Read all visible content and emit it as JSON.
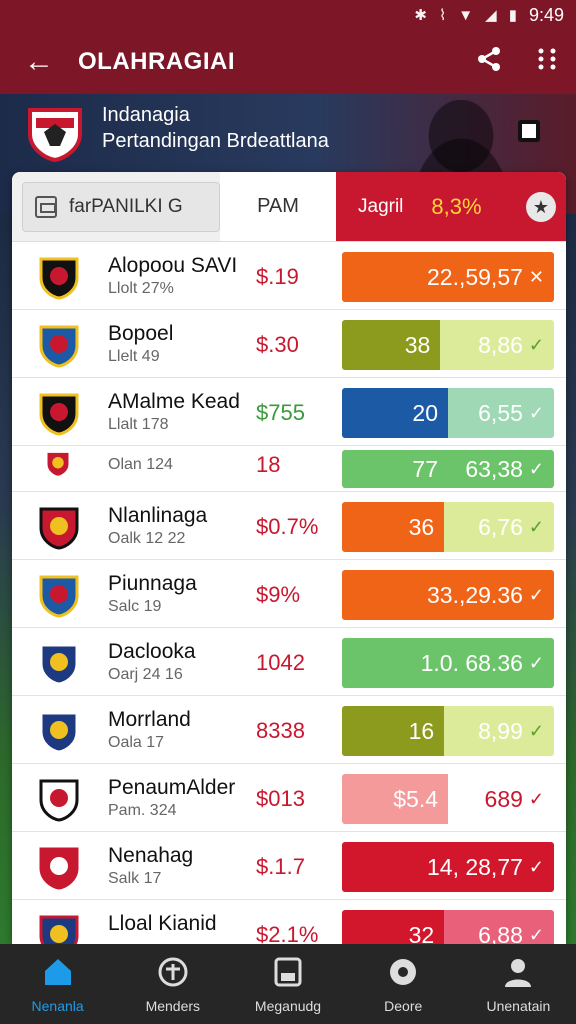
{
  "status": {
    "time": "9:49",
    "icons": [
      "bluetooth-icon",
      "vibrate-icon",
      "wifi-icon",
      "signal-icon",
      "battery-icon"
    ]
  },
  "appbar": {
    "title": "OLAHRAGIAI"
  },
  "hero": {
    "line1": "Indanagia",
    "line2": "Pertandingan Brdeattlana"
  },
  "tabs": {
    "tab1": "farPANILKI G",
    "tab2": "PAM",
    "tab3": "Jagril",
    "tab3_value": "8,3%"
  },
  "colors": {
    "primary": "#7d1626",
    "accent_red": "#c8182f",
    "orange": "#f06418",
    "olive": "#8c9a1e",
    "blue": "#1d5aa6",
    "green": "#6cc46a",
    "nav_active": "#1e9be8"
  },
  "rows": [
    {
      "name": "Alopoou SAVI",
      "sub": "Llolt 27%",
      "price": "$.19",
      "price_color": "#c8182f",
      "segs": [
        {
          "text": "22.,59,57",
          "check": "✕",
          "color": "#f06418",
          "flex": 1
        }
      ]
    },
    {
      "name": "Bopoel",
      "sub": "Llelt 49",
      "price": "$.30",
      "price_color": "#c8182f",
      "segs": [
        {
          "text": "38",
          "check": "",
          "color": "#8c9a1e",
          "flex": 0.46
        },
        {
          "text": "8,86",
          "check": "✓",
          "color": "#dceb9a",
          "flex": 0.54,
          "dark": true
        }
      ]
    },
    {
      "name": "AMalme Kead",
      "sub": "Llalt 178",
      "price": "$755",
      "price_color": "#3a9a3a",
      "segs": [
        {
          "text": "20",
          "check": "",
          "color": "#1d5aa6",
          "flex": 0.5
        },
        {
          "text": "6,55",
          "check": "✓",
          "color": "#9ed8b4",
          "flex": 0.5
        }
      ]
    },
    {
      "name": "",
      "sub": "Olan 124",
      "price": "18",
      "price_color": "#c8182f",
      "short": true,
      "segs": [
        {
          "text": "77",
          "check": "",
          "color": "#6cc46a",
          "flex": 0.5
        },
        {
          "text": "63,38",
          "check": "✓",
          "color": "#6cc46a",
          "flex": 0.5
        }
      ]
    },
    {
      "name": "Nlanlinaga",
      "sub": "Oalk 12 22",
      "price": "$0.7%",
      "price_color": "#c8182f",
      "segs": [
        {
          "text": "36",
          "check": "",
          "color": "#f06418",
          "flex": 0.48
        },
        {
          "text": "6,76",
          "check": "✓",
          "color": "#dceb9a",
          "flex": 0.52
        }
      ]
    },
    {
      "name": "Piunnaga",
      "sub": "Salc 19",
      "price": "$9%",
      "price_color": "#c8182f",
      "segs": [
        {
          "text": "33.,29.36",
          "check": "✓",
          "color": "#f06418",
          "flex": 1
        }
      ]
    },
    {
      "name": "Daclooka",
      "sub": "Oarj 24 16",
      "price": "1042",
      "price_color": "#c8182f",
      "segs": [
        {
          "text": "1.0. 68.36",
          "check": "✓",
          "color": "#6cc46a",
          "flex": 1
        }
      ]
    },
    {
      "name": "Morrland",
      "sub": "Oala 17",
      "price": "8338",
      "price_color": "#c8182f",
      "segs": [
        {
          "text": "16",
          "check": "",
          "color": "#8c9a1e",
          "flex": 0.48
        },
        {
          "text": "8,99",
          "check": "✓",
          "color": "#dceb9a",
          "flex": 0.52
        }
      ]
    },
    {
      "name": "PenaumAlder",
      "sub": "Pam. 324",
      "price": "$013",
      "price_color": "#c8182f",
      "segs": [
        {
          "text": "$5.4",
          "check": "",
          "color": "#f49a9a",
          "flex": 0.5
        },
        {
          "text": "689",
          "check": "✓",
          "color": "#ffffff",
          "flex": 0.5,
          "red": true
        }
      ]
    },
    {
      "name": "Nenahag",
      "sub": "Salk 17",
      "price": "$.1.7",
      "price_color": "#c8182f",
      "segs": [
        {
          "text": "14, 28,77",
          "check": "✓",
          "color": "#d2172d",
          "flex": 1
        }
      ]
    },
    {
      "name": "Lloal Kianid",
      "sub": "",
      "price": "$2.1%",
      "price_color": "#c8182f",
      "segs": [
        {
          "text": "32",
          "check": "",
          "color": "#d2172d",
          "flex": 0.48
        },
        {
          "text": "6,88",
          "check": "✓",
          "color": "#e8607a",
          "flex": 0.52
        }
      ]
    }
  ],
  "nav": [
    {
      "label": "Nenanla",
      "icon": "home-icon",
      "active": true
    },
    {
      "label": "Menders",
      "icon": "ball-icon",
      "active": false
    },
    {
      "label": "Meganudg",
      "icon": "save-icon",
      "active": false
    },
    {
      "label": "Deore",
      "icon": "medal-icon",
      "active": false
    },
    {
      "label": "Unenatain",
      "icon": "user-icon",
      "active": false
    }
  ]
}
